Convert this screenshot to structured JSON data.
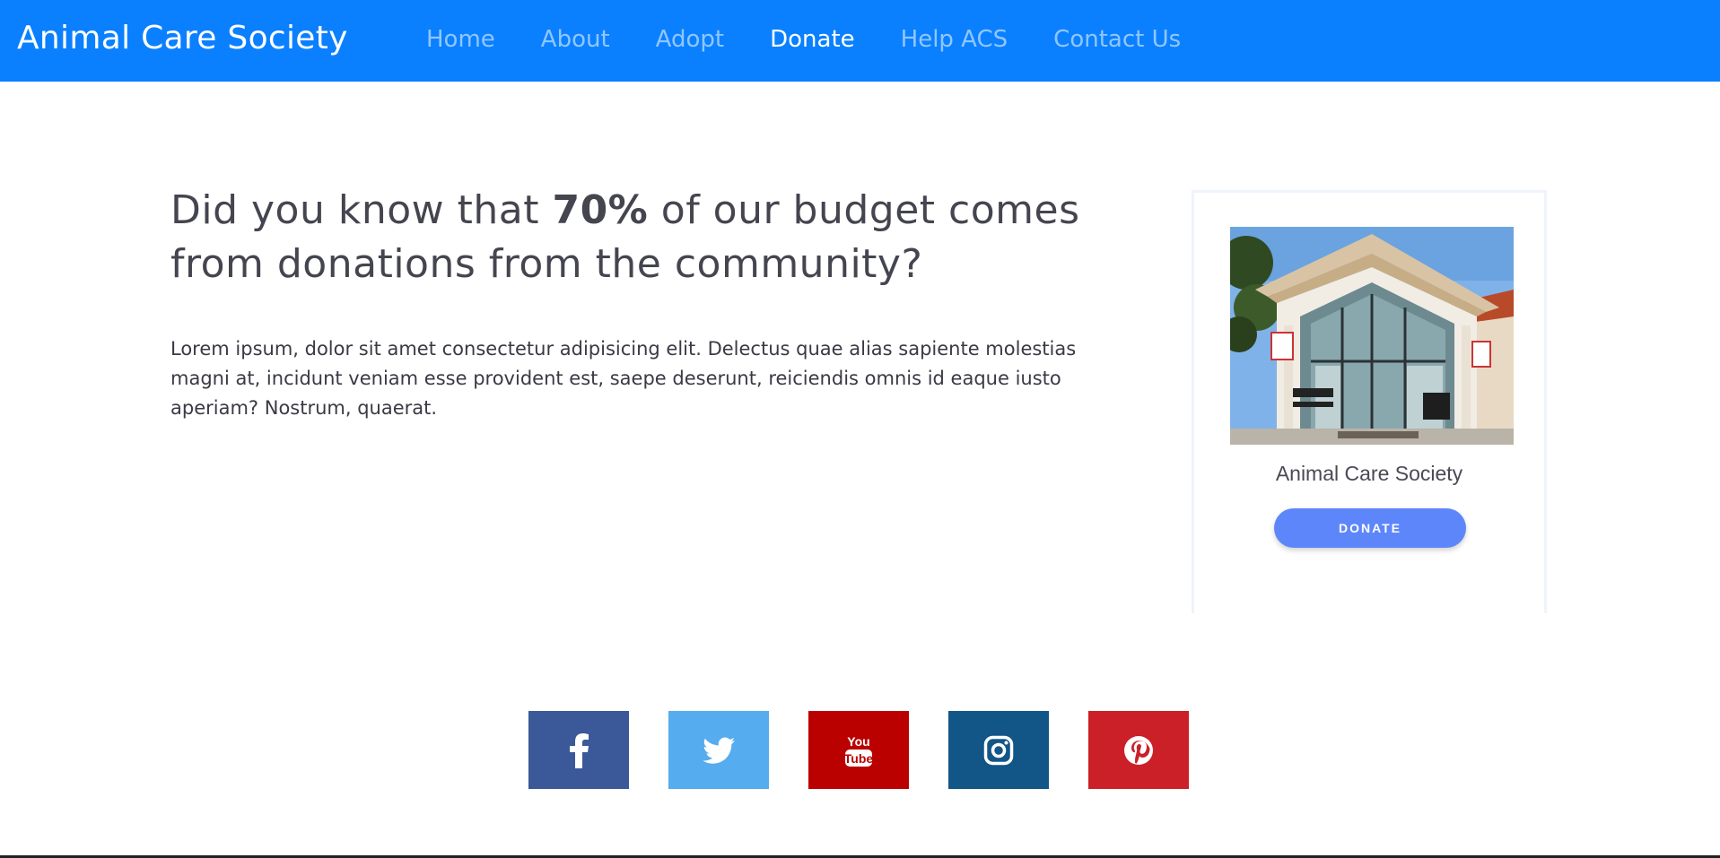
{
  "navbar": {
    "brand": "Animal Care Society",
    "items": [
      {
        "label": "Home",
        "active": false
      },
      {
        "label": "About",
        "active": false
      },
      {
        "label": "Adopt",
        "active": false
      },
      {
        "label": "Donate",
        "active": true
      },
      {
        "label": "Help ACS",
        "active": false
      },
      {
        "label": "Contact Us",
        "active": false
      }
    ],
    "background_color": "#0a80ff"
  },
  "main": {
    "headline_before": "Did you know that ",
    "headline_bold": "70%",
    "headline_after": " of our budget comes from donations from the community?",
    "body": "Lorem ipsum, dolor sit amet consectetur adipisicing elit. Delectus quae alias sapiente molestias magni at, incidunt veniam esse provident est, saepe deserunt, reiciendis omnis id eaque iusto aperiam? Nostrum, quaerat."
  },
  "card": {
    "title": "Animal Care Society",
    "button_label": "DONATE",
    "button_color": "#5e86fb",
    "image": "animal-care-society-building-photo"
  },
  "social": [
    {
      "name": "facebook",
      "icon": "facebook-icon",
      "color": "#3b5998"
    },
    {
      "name": "twitter",
      "icon": "twitter-icon",
      "color": "#55acee"
    },
    {
      "name": "youtube",
      "icon": "youtube-icon",
      "color": "#bb0000"
    },
    {
      "name": "instagram",
      "icon": "instagram-icon",
      "color": "#125688"
    },
    {
      "name": "pinterest",
      "icon": "pinterest-icon",
      "color": "#cb2027"
    }
  ]
}
